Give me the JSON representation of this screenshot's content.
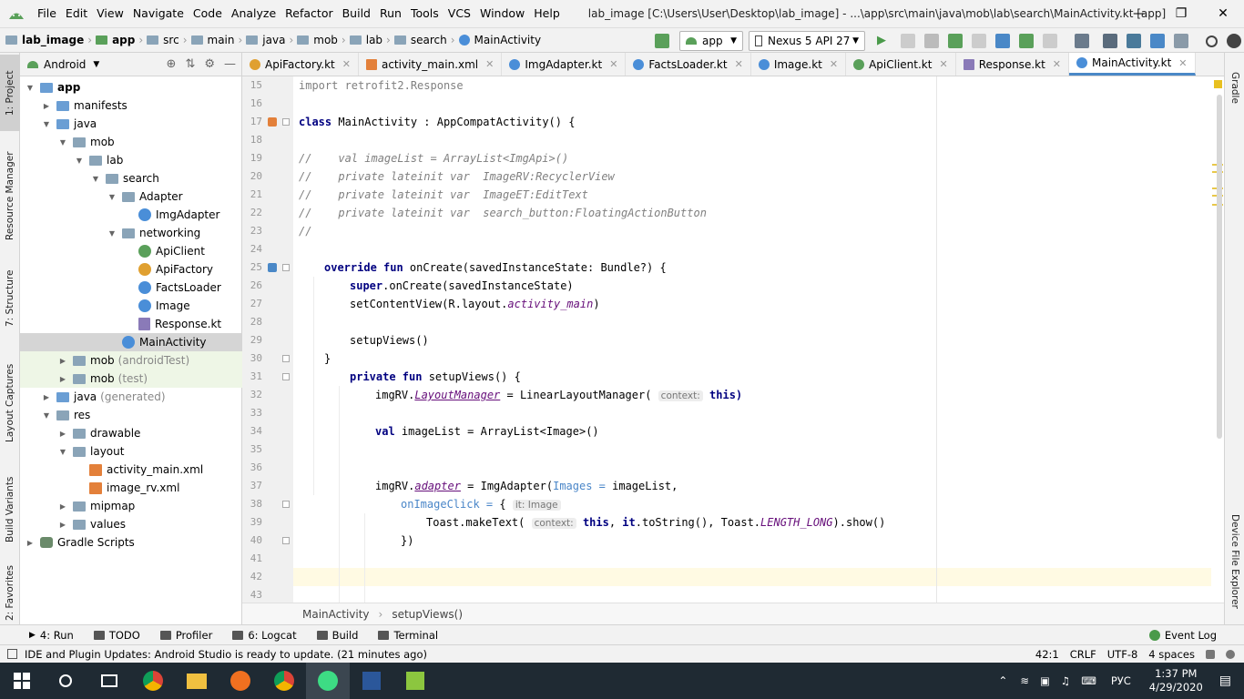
{
  "menubar": {
    "items": [
      "File",
      "Edit",
      "View",
      "Navigate",
      "Code",
      "Analyze",
      "Refactor",
      "Build",
      "Run",
      "Tools",
      "VCS",
      "Window",
      "Help"
    ],
    "title": "lab_image [C:\\Users\\User\\Desktop\\lab_image] - ...\\app\\src\\main\\java\\mob\\lab\\search\\MainActivity.kt [app]"
  },
  "navbar": {
    "crumbs": [
      "lab_image",
      "app",
      "src",
      "main",
      "java",
      "mob",
      "lab",
      "search",
      "MainActivity"
    ],
    "run_config": "app",
    "device": "Nexus 5 API 27"
  },
  "left_strip": {
    "project": "1: Project",
    "resource_manager": "Resource Manager",
    "structure": "7: Structure",
    "layout_captures": "Layout Captures",
    "build_variants": "Build Variants",
    "favorites": "2: Favorites"
  },
  "right_strip": {
    "gradle": "Gradle",
    "device_explorer": "Device File Explorer"
  },
  "project_panel": {
    "view": "Android",
    "tree": [
      {
        "label": "app",
        "bold": true
      },
      {
        "label": "manifests"
      },
      {
        "label": "java"
      },
      {
        "label": "mob"
      },
      {
        "label": "lab"
      },
      {
        "label": "search"
      },
      {
        "label": "Adapter"
      },
      {
        "label": "ImgAdapter"
      },
      {
        "label": "networking"
      },
      {
        "label": "ApiClient"
      },
      {
        "label": "ApiFactory"
      },
      {
        "label": "FactsLoader"
      },
      {
        "label": "Image"
      },
      {
        "label": "Response.kt"
      },
      {
        "label": "MainActivity"
      },
      {
        "label": "mob",
        "suffix": "(androidTest)"
      },
      {
        "label": "mob",
        "suffix": "(test)"
      },
      {
        "label": "java",
        "suffix": "(generated)"
      },
      {
        "label": "res"
      },
      {
        "label": "drawable"
      },
      {
        "label": "layout"
      },
      {
        "label": "activity_main.xml"
      },
      {
        "label": "image_rv.xml"
      },
      {
        "label": "mipmap"
      },
      {
        "label": "values"
      },
      {
        "label": "Gradle Scripts"
      }
    ]
  },
  "tabs": [
    "ApiFactory.kt",
    "activity_main.xml",
    "ImgAdapter.kt",
    "FactsLoader.kt",
    "Image.kt",
    "ApiClient.kt",
    "Response.kt",
    "MainActivity.kt"
  ],
  "editor": {
    "line_numbers": [
      "15",
      "16",
      "17",
      "18",
      "19",
      "20",
      "21",
      "22",
      "23",
      "24",
      "25",
      "26",
      "27",
      "28",
      "29",
      "30",
      "31",
      "32",
      "33",
      "34",
      "35",
      "36",
      "37",
      "38",
      "39",
      "40",
      "41",
      "42",
      "43"
    ],
    "l15": "import retrofit2.Response",
    "l17a": "class",
    "l17b": " MainActivity : AppCompatActivity() {",
    "l19": "//    val imageList = ArrayList<ImgApi>()",
    "l20": "//    private lateinit var  ImageRV:RecyclerView",
    "l21": "//    private lateinit var  ImageET:EditText",
    "l22": "//    private lateinit var  search_button:FloatingActionButton",
    "l23": "//",
    "l25a": "override fun",
    "l25b": " onCreate(savedInstanceState: Bundle?) {",
    "l26a": "super",
    "l26b": ".onCreate(savedInstanceState)",
    "l27a": "setContentView(R.layout.",
    "l27b": "activity_main",
    "l27c": ")",
    "l29": "setupViews()",
    "l30": "}",
    "l31a": "private fun",
    "l31b": " setupViews() {",
    "l32a": "imgRV.",
    "l32b": "LayoutManager",
    "l32c": " = LinearLayoutManager( ",
    "l32h": "context:",
    "l32d": " this)",
    "l34a": "val",
    "l34b": " imageList = ArrayList<Image>()",
    "l37a": "imgRV.",
    "l37b": "adapter",
    "l37c": " = ImgAdapter(",
    "l37d": "Images =",
    "l37e": " imageList,",
    "l38a": "onImageClick =",
    "l38b": " { ",
    "l38h": "it: Image",
    "l39a": "Toast.makeText( ",
    "l39h": "context:",
    "l39b": " this",
    "l39c": ", ",
    "l39d": "it",
    "l39e": ".toString(), Toast.",
    "l39f": "LENGTH_LONG",
    "l39g": ").show()",
    "l40": "})"
  },
  "editor_crumb": {
    "a": "MainActivity",
    "b": "setupViews()"
  },
  "toolwindows": {
    "run": "4: Run",
    "todo": "TODO",
    "profiler": "Profiler",
    "logcat": "6: Logcat",
    "build": "Build",
    "terminal": "Terminal",
    "event_log": "Event Log"
  },
  "status": {
    "message": "IDE and Plugin Updates: Android Studio is ready to update. (21 minutes ago)",
    "position": "42:1",
    "line_sep": "CRLF",
    "encoding": "UTF-8",
    "indent": "4 spaces"
  },
  "taskbar": {
    "lang": "РУС",
    "time": "1:37 PM",
    "date": "4/29/2020"
  },
  "colors": {
    "accent": "#4a88c7",
    "keyword": "#000080",
    "comment": "#808080",
    "taskbar": "#1f2a33"
  }
}
